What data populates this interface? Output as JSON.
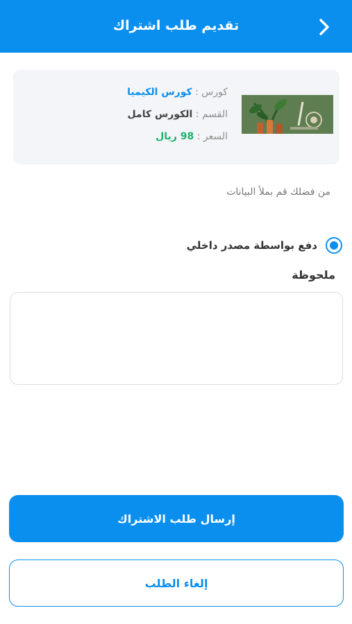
{
  "header": {
    "title": "تقديم طلب اشتراك",
    "back_icon": "chevron-right-icon"
  },
  "card": {
    "image_icon": "course-thumbnail",
    "course_key": "كورس :",
    "course_value": "كورس الكيميا",
    "section_key": "القسم :",
    "section_value": "الكورس كامل",
    "price_key": "السعر :",
    "price_value": "98 ريال"
  },
  "form": {
    "prompt": "من فضلك قم بملأ البيانات",
    "payment_option": "دفع بواسطة مصدر داخلي",
    "payment_selected": true,
    "note_label": "ملحوظة",
    "note_value": ""
  },
  "actions": {
    "submit_label": "إرسال طلب الاشتراك",
    "cancel_label": "إلغاء الطلب"
  },
  "colors": {
    "primary": "#0a8fef",
    "price": "#1bb26b",
    "card_bg": "#f4f5f8"
  }
}
